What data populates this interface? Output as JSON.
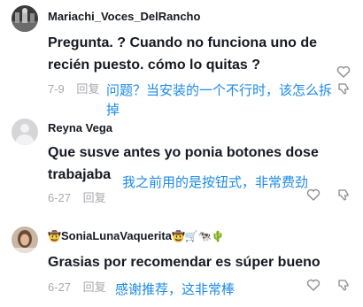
{
  "comments": [
    {
      "username": "Mariachi_Voces_DelRancho",
      "text": "Pregunta. ? Cuando no funciona uno de recién puesto. cómo lo quitas ?",
      "date": "7-9",
      "reply_label": "回复",
      "translation_line1": "问题？当安装的一个不行时，该怎么拆",
      "translation_line2": "掉"
    },
    {
      "username": "Reyna Vega",
      "text": "Que susve antes yo ponia botones dose trabajaba",
      "date": "6-27",
      "reply_label": "回复",
      "translation": "我之前用的是按钮式，非常费劲"
    },
    {
      "username_prefix": "🤠",
      "username": "SoniaLunaVaquerita",
      "username_suffix": "🤠🛒🐄🌵",
      "text": "Grasias por recomendar es súper bueno",
      "date": "6-27",
      "reply_label": "回复",
      "translation": "感谢推荐，这非常棒"
    }
  ],
  "icons": {
    "like": "heart-outline-icon",
    "dislike": "thumbs-down-icon"
  },
  "colors": {
    "text": "#161823",
    "meta": "#a8a9ad",
    "translation": "#1d8ae8"
  }
}
